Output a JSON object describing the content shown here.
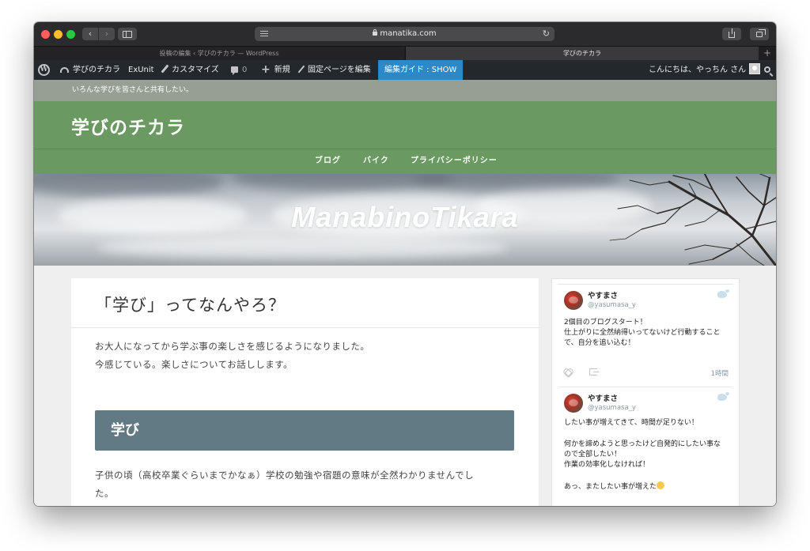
{
  "browser": {
    "url": "manatika.com",
    "tabs": [
      {
        "label": "投稿の編集 ‹ 学びのチカラ — WordPress",
        "active": false
      },
      {
        "label": "学びのチカラ",
        "active": true
      }
    ],
    "new_tab": "+",
    "nav_back": "‹",
    "nav_forward": "›",
    "reload": "↻"
  },
  "adminbar": {
    "site_name": "学びのチカラ",
    "exunit": "ExUnit",
    "customize": "カスタマイズ",
    "comments_count": "0",
    "new": "新規",
    "edit_page": "固定ページを編集",
    "guide": "編集ガイド : SHOW",
    "greeting": "こんにちは、やっちん さん"
  },
  "site": {
    "tagline": "いろんな学びを皆さんと共有したい。",
    "title": "学びのチカラ",
    "nav": [
      "ブログ",
      "バイク",
      "プライバシーポリシー"
    ],
    "hero_title": "ManabinoTikara"
  },
  "article": {
    "title": "「学び」ってなんやろ？",
    "intro_lines": [
      "お大人になってから学ぶ事の楽しさを感じるようになりました。",
      "今感じている。楽しさについてお話しします。"
    ],
    "section_heading": "学び",
    "body_lines": [
      "子供の頃（高校卒業ぐらいまでかなぁ）学校の勉強や宿題の意味が全然わかりませんでし",
      "た。"
    ]
  },
  "tweets": [
    {
      "name": "やすまさ",
      "handle": "@yasumasa_y",
      "lines": [
        "2個目のブログスタート！",
        "仕上がりに全然納得いってないけど行動すること",
        "で、自分を追い込む！"
      ],
      "time": "1時間"
    },
    {
      "name": "やすまさ",
      "handle": "@yasumasa_y",
      "lines": [
        "したい事が増えてきて、時間が足りない！",
        "",
        "何かを諦めようと思ったけど自発的にしたい事な",
        "ので全部したい！",
        "作業の効率化しなければ！",
        "",
        "あっ、またしたい事が増えた"
      ]
    }
  ],
  "colors": {
    "header_green": "#6a9a61",
    "tagline_bar": "#979f94",
    "section_heading": "#617a84",
    "admin_bar": "#23282d",
    "admin_active": "#2b89c8"
  }
}
